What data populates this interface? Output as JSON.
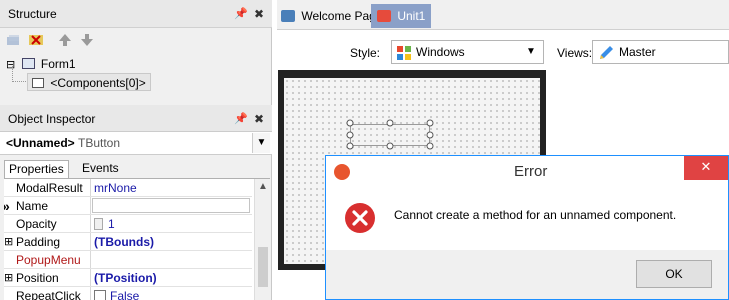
{
  "structure": {
    "title": "Structure",
    "tree": [
      {
        "label": "Form1",
        "expander": "⊟"
      },
      {
        "label": "<Components[0]>"
      }
    ]
  },
  "inspector": {
    "title": "Object Inspector",
    "object_name": "<Unnamed>",
    "object_type": "TButton",
    "tabs": [
      "Properties",
      "Events"
    ],
    "rows": [
      {
        "name": "ModalResult",
        "value": "mrNone",
        "marker": "",
        "name_color": "#000000",
        "value_color": "#1a1aa8"
      },
      {
        "name": "Name",
        "value": "",
        "marker": "»",
        "name_color": "#000000",
        "value_color": "#000000"
      },
      {
        "name": "Opacity",
        "value": "1",
        "marker": "",
        "name_color": "#000000",
        "value_color": "#1a1aa8"
      },
      {
        "name": "Padding",
        "value": "(TBounds)",
        "marker": "⊞",
        "name_color": "#000000",
        "value_color": "#1a1aa8"
      },
      {
        "name": "PopupMenu",
        "value": "",
        "marker": "",
        "name_color": "#b01818",
        "value_color": "#000000"
      },
      {
        "name": "Position",
        "value": "(TPosition)",
        "marker": "⊞",
        "name_color": "#000000",
        "value_color": "#1a1aa8"
      },
      {
        "name": "RepeatClick",
        "value": "False",
        "marker": "",
        "name_color": "#000000",
        "value_color": "#1a1aa8"
      }
    ]
  },
  "designer": {
    "tabs": [
      "Welcome Page",
      "Unit1"
    ],
    "style_label": "Style:",
    "style_value": "Windows",
    "views_label": "Views:",
    "views_value": "Master"
  },
  "dialog": {
    "title": "Error",
    "message": "Cannot create a method for an unnamed component.",
    "ok_label": "OK",
    "close_glyph": "✕"
  }
}
